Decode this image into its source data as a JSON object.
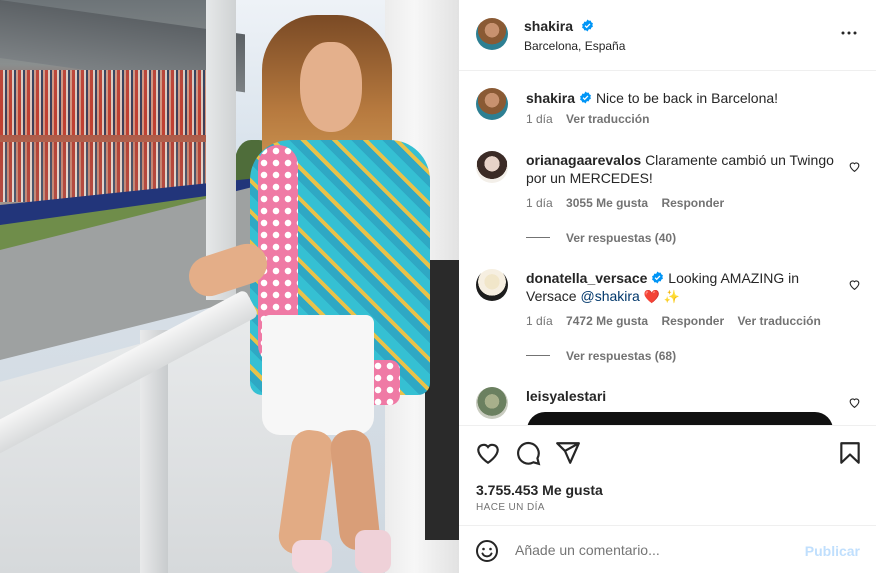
{
  "header": {
    "username": "shakira",
    "location": "Barcelona, España",
    "more_icon": "more-horizontal-icon"
  },
  "caption": {
    "username": "shakira",
    "text": "Nice to be back in Barcelona!",
    "time": "1 día",
    "translate": "Ver traducción"
  },
  "comments": [
    {
      "username": "orianagaarevalos",
      "text": "Claramente cambió un Twingo por un MERCEDES!",
      "time": "1 día",
      "likes": "3055 Me gusta",
      "reply": "Responder",
      "view_replies": "Ver respuestas (40)"
    },
    {
      "username": "donatella_versace",
      "text_pre": "Looking AMAZING in Versace ",
      "mention": "@shakira",
      "emojis": "❤️ ✨",
      "time": "1 día",
      "likes": "7472 Me gusta",
      "reply": "Responder",
      "translate": "Ver traducción",
      "view_replies": "Ver respuestas (68)"
    },
    {
      "username": "leisyalestari"
    }
  ],
  "stats": {
    "likes": "3.755.453 Me gusta",
    "posted": "HACE UN DÍA"
  },
  "composer": {
    "placeholder": "Añade un comentario...",
    "post_label": "Publicar"
  },
  "colors": {
    "verified": "#0095f6",
    "muted": "#737373",
    "post_disabled": "#c0dffd",
    "mention": "#00376b"
  }
}
